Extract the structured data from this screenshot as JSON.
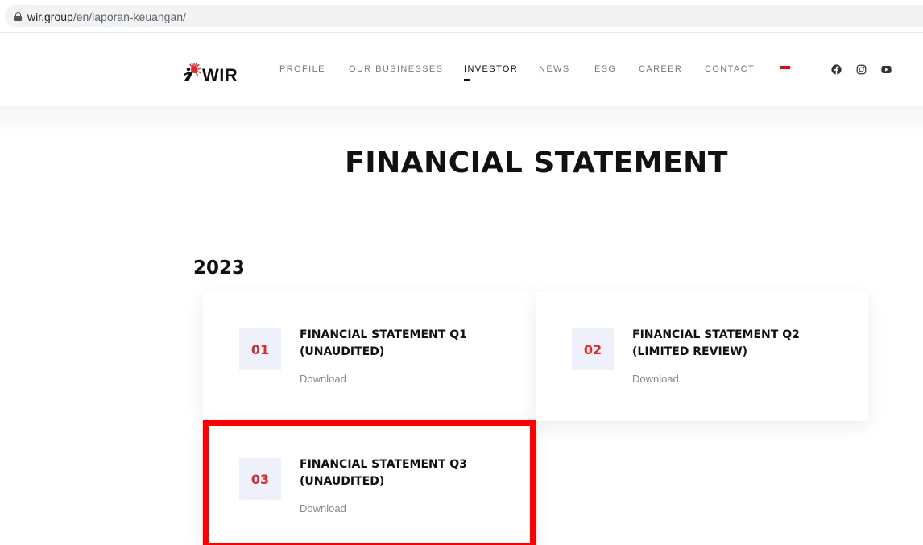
{
  "browser": {
    "url_host": "wir.group",
    "url_path": "/en/laporan-keuangan/"
  },
  "header": {
    "logo_text": "WIR",
    "nav": [
      {
        "label": "PROFILE",
        "active": false
      },
      {
        "label": "OUR BUSINESSES",
        "active": false
      },
      {
        "label": "INVESTOR",
        "active": true
      },
      {
        "label": "NEWS",
        "active": false
      },
      {
        "label": "ESG",
        "active": false
      },
      {
        "label": "CAREER",
        "active": false
      },
      {
        "label": "CONTACT",
        "active": false
      }
    ],
    "language_flag": "indonesia-flag-icon",
    "social_icons": [
      "facebook-icon",
      "instagram-icon",
      "youtube-icon"
    ]
  },
  "page": {
    "title": "FINANCIAL STATEMENT",
    "year": "2023"
  },
  "cards": [
    {
      "number": "01",
      "title_line1": "FINANCIAL STATEMENT Q1",
      "title_line2": "(UNAUDITED)",
      "link": "Download"
    },
    {
      "number": "02",
      "title_line1": "FINANCIAL STATEMENT Q2",
      "title_line2": "(LIMITED REVIEW)",
      "link": "Download"
    },
    {
      "number": "03",
      "title_line1": "FINANCIAL STATEMENT Q3",
      "title_line2": "(UNAUDITED)",
      "link": "Download"
    }
  ],
  "colors": {
    "accent_red": "#e0282b",
    "highlight_border": "#ff0000",
    "number_tile_bg": "#eef1fa"
  }
}
